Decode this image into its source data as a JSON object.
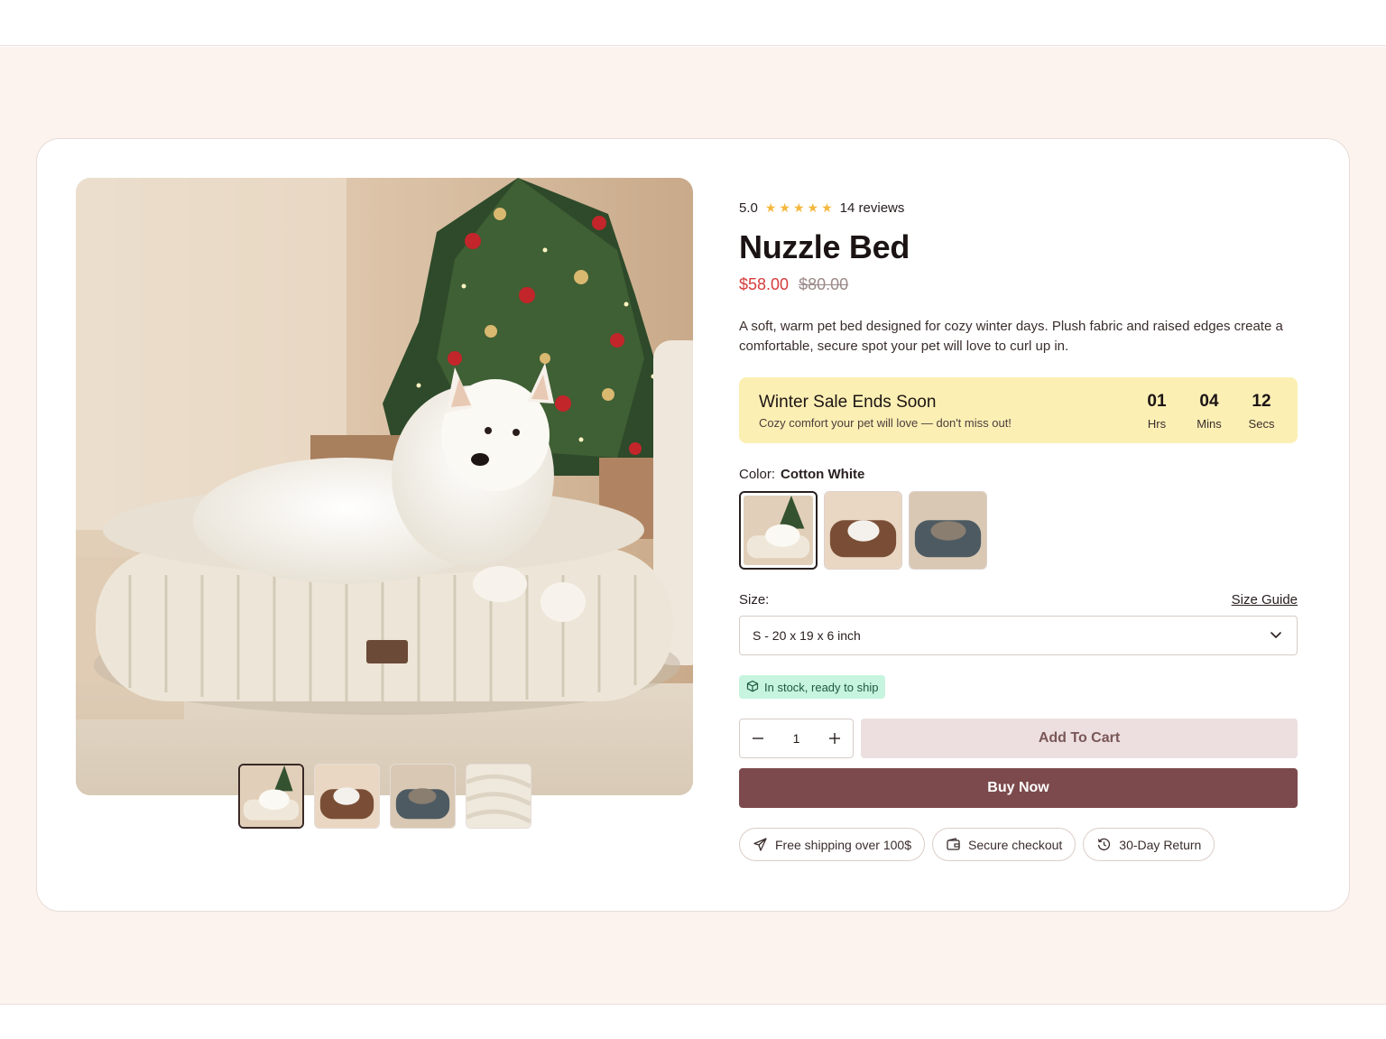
{
  "rating": {
    "score": "5.0",
    "stars": 5,
    "reviews": "14 reviews"
  },
  "product": {
    "title": "Nuzzle Bed",
    "price_now": "$58.00",
    "price_old": "$80.00",
    "description": "A soft, warm pet bed designed for cozy winter days. Plush fabric and raised edges create a comfortable, secure spot your pet will love to curl up in."
  },
  "sale": {
    "title": "Winter Sale Ends Soon",
    "subtitle": "Cozy comfort your pet will love — don't miss out!",
    "timer": [
      {
        "value": "01",
        "label": "Hrs"
      },
      {
        "value": "04",
        "label": "Mins"
      },
      {
        "value": "12",
        "label": "Secs"
      }
    ]
  },
  "color": {
    "label": "Color:",
    "selected": "Cotton White"
  },
  "size": {
    "label": "Size:",
    "guide": "Size Guide",
    "selected": "S - 20 x 19 x 6 inch"
  },
  "stock": {
    "text": "In stock, ready to ship"
  },
  "cart": {
    "quantity": "1",
    "add_label": "Add To Cart",
    "buy_label": "Buy Now"
  },
  "badges": [
    {
      "label": "Free shipping over 100$",
      "icon": "plane-icon"
    },
    {
      "label": "Secure checkout",
      "icon": "wallet-icon"
    },
    {
      "label": "30-Day Return",
      "icon": "return-clock-icon"
    }
  ],
  "colors": {
    "accent": "#7c4a4c",
    "sale_price": "#d63b3b",
    "sale_bg": "#fcefb4",
    "stock_bg": "#c6f4de",
    "star": "#f4b73e",
    "page_bg": "#fcf2ee"
  }
}
